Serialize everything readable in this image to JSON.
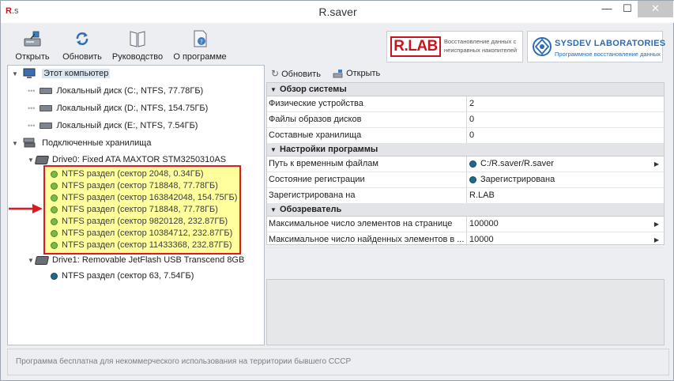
{
  "window": {
    "title": "R.saver",
    "icon_text": "R",
    "icon_sub": ".s",
    "minimize_label": "—",
    "maximize_label": "☐",
    "close_label": "✕"
  },
  "toolbar": {
    "open_label": "Открыть",
    "refresh_label": "Обновить",
    "guide_label": "Руководство",
    "about_label": "О программе"
  },
  "logos": {
    "rlab_brand": "R.LAB",
    "rlab_desc": "Восстановление данных с неисправных накопителей",
    "sysdev_name": "SYSDEV LABORATORIES",
    "sysdev_tag": "Программное восстановление данных"
  },
  "tree": {
    "computer": "Этот компьютер",
    "local_disks": [
      "Локальный диск (C:, NTFS, 77.78ГБ)",
      "Локальный диск (D:, NTFS, 154.75ГБ)",
      "Локальный диск (E:, NTFS, 7.54ГБ)"
    ],
    "connected": "Подключенные хранилища",
    "drive0": "Drive0: Fixed ATA MAXTOR STM3250310AS",
    "drive0_partitions": [
      "NTFS раздел (сектор 2048, 0.34ГБ)",
      "NTFS раздел (сектор 718848, 77.78ГБ)",
      "NTFS раздел (сектор 163842048, 154.75ГБ)",
      "NTFS раздел (сектор 718848, 77.78ГБ)",
      "NTFS раздел (сектор 9820128, 232.87ГБ)",
      "NTFS раздел (сектор 10384712, 232.87ГБ)",
      "NTFS раздел (сектор 11433368, 232.87ГБ)"
    ],
    "drive1": "Drive1: Removable JetFlash USB Transcend 8GB",
    "drive1_partition": "NTFS раздел (сектор 63, 7.54ГБ)"
  },
  "right_toolbar": {
    "refresh_label": "Обновить",
    "open_label": "Открыть"
  },
  "grid": {
    "sections": [
      {
        "title": "Обзор системы",
        "rows": [
          {
            "key": "Физические устройства",
            "value": "2"
          },
          {
            "key": "Файлы образов дисков",
            "value": "0"
          },
          {
            "key": "Составные хранилища",
            "value": "0"
          }
        ]
      },
      {
        "title": "Настройки программы",
        "rows": [
          {
            "key": "Путь к временным файлам",
            "value": "C:/R.saver/R.saver"
          },
          {
            "key": "Состояние регистрации",
            "value": "Зарегистрирована"
          },
          {
            "key": "Зарегистрирована на",
            "value": "R.LAB"
          }
        ]
      },
      {
        "title": "Обозреватель",
        "rows": [
          {
            "key": "Максимальное число элементов на странице",
            "value": "100000"
          },
          {
            "key": "Максимальное число найденных элементов в ...",
            "value": "10000"
          }
        ]
      }
    ]
  },
  "status": {
    "text": "Программа бесплатна для некоммерческого использования на территории бывшего СССР"
  },
  "colors": {
    "highlight_fill": "#ffff9c",
    "highlight_border": "#e0191f",
    "partition_dot": "#7ab84a",
    "usb_partition_dot": "#1f6a8c",
    "accent_blue": "#2a6bb5"
  }
}
